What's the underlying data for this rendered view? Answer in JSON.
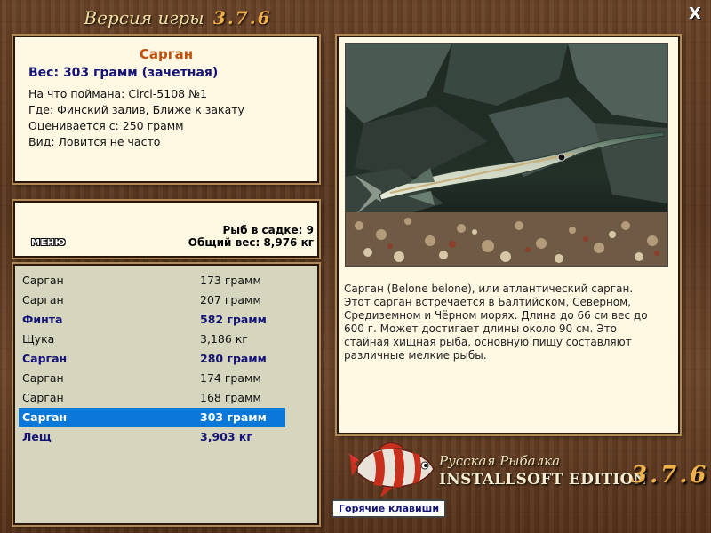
{
  "window": {
    "title": "Версия игры",
    "version": "3.7.6",
    "close_label": "X"
  },
  "info": {
    "fish_name": "Сарган",
    "weight_line": "Вес: 303 грамм (зачетная)",
    "lines": [
      "На что поймана: Circl-5108 №1",
      "Где: Финский залив, Ближе к закату",
      "Оценивается с: 250 грамм",
      "Вид: Ловится не часто"
    ]
  },
  "summary": {
    "menu_label": "МЕНЮ",
    "count_line": "Рыб в садке: 9",
    "total_line": "Общий вес: 8,976 кг"
  },
  "catch": [
    {
      "name": "Сарган",
      "weight": "173 грамм",
      "highlight": false,
      "selected": false
    },
    {
      "name": "Сарган",
      "weight": "207 грамм",
      "highlight": false,
      "selected": false
    },
    {
      "name": "Финта",
      "weight": "582 грамм",
      "highlight": true,
      "selected": false
    },
    {
      "name": "Щука",
      "weight": "3,186 кг",
      "highlight": false,
      "selected": false
    },
    {
      "name": "Сарган",
      "weight": "280 грамм",
      "highlight": true,
      "selected": false
    },
    {
      "name": "Сарган",
      "weight": "174 грамм",
      "highlight": false,
      "selected": false
    },
    {
      "name": "Сарган",
      "weight": "168 грамм",
      "highlight": false,
      "selected": false
    },
    {
      "name": "Сарган",
      "weight": "303 грамм",
      "highlight": true,
      "selected": true
    },
    {
      "name": "Лещ",
      "weight": "3,903 кг",
      "highlight": true,
      "selected": false
    }
  ],
  "description": "Сарган (Belone belone), или атлантический сарган. Этот сарган встречается в Балтийском, Северном, Средиземном и Чёрном морях. Длина до 66 см вес до 600 г. Может достигает длины около 90 см. Это стайная хищная рыба, основную пищу составляют различные мелкие рыбы.",
  "logo": {
    "line1": "Русская Рыбалка",
    "line2": "INSTALLSOFT EDITION",
    "version": "3.7.6"
  },
  "hotkeys_label": "Горячие клавиши",
  "colors": {
    "accent_name": "#c0500c",
    "highlight_text": "#141478",
    "selection": "#0a78d8",
    "version_gold": "#f0b04a"
  }
}
